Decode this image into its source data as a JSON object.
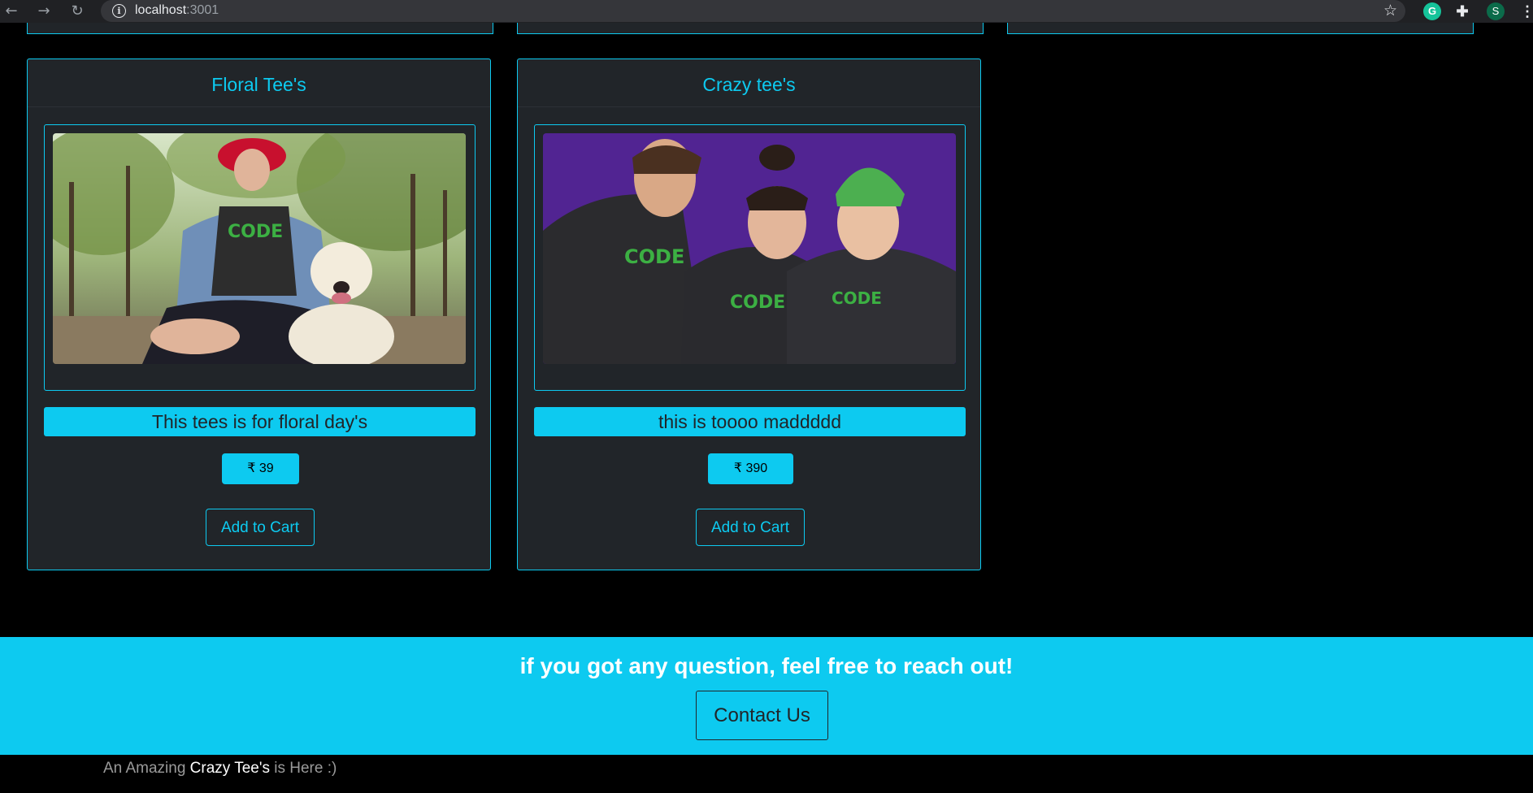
{
  "browser": {
    "url_host": "localhost",
    "url_port": ":3001",
    "profile_initial": "S",
    "grammarly_initial": "G"
  },
  "products": [
    {
      "title": "Floral Tee's",
      "description": "This tees is for floral day's",
      "price": "₹ 39",
      "button_label": "Add to Cart",
      "image_alt": "woman in red hat with dog wearing I write CODE tee"
    },
    {
      "title": "Crazy tee's",
      "description": "this is toooo maddddd",
      "price": "₹ 390",
      "button_label": "Add to Cart",
      "image_alt": "three friends in I write CODE hoodies on purple background"
    }
  ],
  "contact": {
    "heading": "if you got any question, feel free to reach out!",
    "button_label": "Contact Us"
  },
  "footer": {
    "prefix": "An Amazing ",
    "brand": "Crazy Tee's",
    "suffix": " is Here :)"
  },
  "colors": {
    "accent": "#0dcaf0",
    "card_bg": "#212529",
    "page_bg": "#000000"
  }
}
